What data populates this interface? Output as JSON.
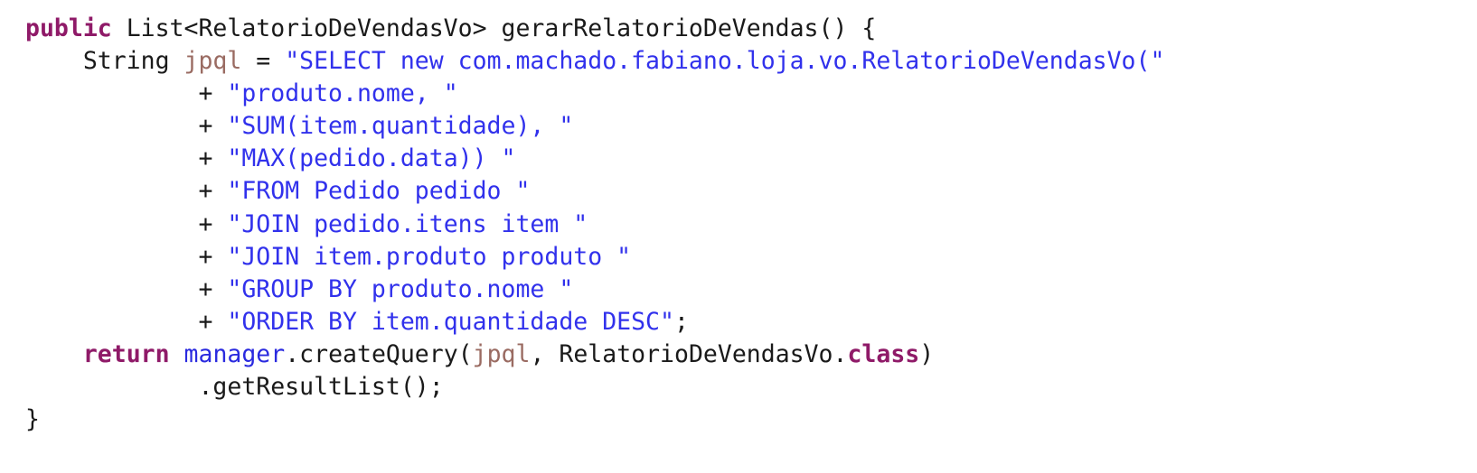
{
  "editor": {
    "language": "java",
    "background_color": "#ffffff",
    "colors": {
      "keyword": "#8f1a68",
      "string": "#3131ec",
      "local_variable": "#9a6b62",
      "field": "#2a2adf",
      "plain": "#1a1a1a"
    }
  },
  "code": {
    "lines": [
      {
        "index": 1,
        "text": "public List<RelatorioDeVendasVo> gerarRelatorioDeVendas() {",
        "tokens": [
          {
            "t": "public",
            "k": "keyword"
          },
          {
            "t": " List<RelatorioDeVendasVo> gerarRelatorioDeVendas() {",
            "k": "plain"
          }
        ]
      },
      {
        "index": 2,
        "text": "    String jpql = \"SELECT new com.machado.fabiano.loja.vo.RelatorioDeVendasVo(\"",
        "tokens": [
          {
            "t": "    String ",
            "k": "plain"
          },
          {
            "t": "jpql",
            "k": "local"
          },
          {
            "t": " = ",
            "k": "plain"
          },
          {
            "t": "\"SELECT new com.machado.fabiano.loja.vo.RelatorioDeVendasVo(\"",
            "k": "string"
          }
        ]
      },
      {
        "index": 3,
        "text": "            + \"produto.nome, \"",
        "tokens": [
          {
            "t": "            + ",
            "k": "plain"
          },
          {
            "t": "\"produto.nome, \"",
            "k": "string"
          }
        ]
      },
      {
        "index": 4,
        "text": "            + \"SUM(item.quantidade), \"",
        "tokens": [
          {
            "t": "            + ",
            "k": "plain"
          },
          {
            "t": "\"SUM(item.quantidade), \"",
            "k": "string"
          }
        ]
      },
      {
        "index": 5,
        "text": "            + \"MAX(pedido.data)) \"",
        "tokens": [
          {
            "t": "            + ",
            "k": "plain"
          },
          {
            "t": "\"MAX(pedido.data)) \"",
            "k": "string"
          }
        ]
      },
      {
        "index": 6,
        "text": "            + \"FROM Pedido pedido \"",
        "tokens": [
          {
            "t": "            + ",
            "k": "plain"
          },
          {
            "t": "\"FROM Pedido pedido \"",
            "k": "string"
          }
        ]
      },
      {
        "index": 7,
        "text": "            + \"JOIN pedido.itens item \"",
        "tokens": [
          {
            "t": "            + ",
            "k": "plain"
          },
          {
            "t": "\"JOIN pedido.itens item \"",
            "k": "string"
          }
        ]
      },
      {
        "index": 8,
        "text": "            + \"JOIN item.produto produto \"",
        "tokens": [
          {
            "t": "            + ",
            "k": "plain"
          },
          {
            "t": "\"JOIN item.produto produto \"",
            "k": "string"
          }
        ]
      },
      {
        "index": 9,
        "text": "            + \"GROUP BY produto.nome \"",
        "tokens": [
          {
            "t": "            + ",
            "k": "plain"
          },
          {
            "t": "\"GROUP BY produto.nome \"",
            "k": "string"
          }
        ]
      },
      {
        "index": 10,
        "text": "            + \"ORDER BY item.quantidade DESC\";",
        "tokens": [
          {
            "t": "            + ",
            "k": "plain"
          },
          {
            "t": "\"ORDER BY item.quantidade DESC\"",
            "k": "string"
          },
          {
            "t": ";",
            "k": "plain"
          }
        ]
      },
      {
        "index": 11,
        "text": "    return manager.createQuery(jpql, RelatorioDeVendasVo.class)",
        "tokens": [
          {
            "t": "    ",
            "k": "plain"
          },
          {
            "t": "return",
            "k": "keyword"
          },
          {
            "t": " ",
            "k": "plain"
          },
          {
            "t": "manager",
            "k": "field"
          },
          {
            "t": ".createQuery(",
            "k": "plain"
          },
          {
            "t": "jpql",
            "k": "local"
          },
          {
            "t": ", RelatorioDeVendasVo.",
            "k": "plain"
          },
          {
            "t": "class",
            "k": "keyword"
          },
          {
            "t": ")",
            "k": "plain"
          }
        ]
      },
      {
        "index": 12,
        "text": "            .getResultList();",
        "tokens": [
          {
            "t": "            .getResultList();",
            "k": "plain"
          }
        ]
      },
      {
        "index": 13,
        "text": "}",
        "tokens": [
          {
            "t": "}",
            "k": "plain"
          }
        ]
      }
    ]
  }
}
